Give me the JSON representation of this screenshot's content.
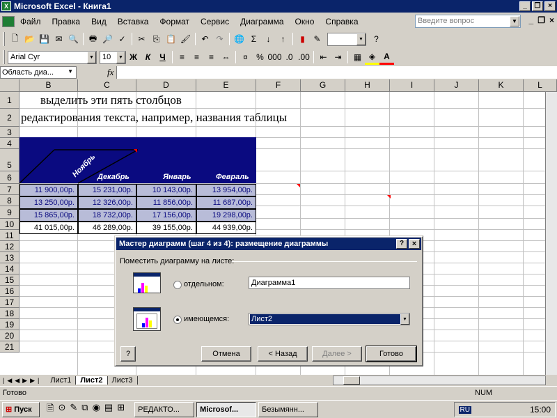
{
  "window": {
    "title": "Microsoft Excel - Книга1",
    "icon": "excel-icon"
  },
  "menu": [
    "Файл",
    "Правка",
    "Вид",
    "Вставка",
    "Формат",
    "Сервис",
    "Диаграмма",
    "Окно",
    "Справка"
  ],
  "help_placeholder": "Введите вопрос",
  "font": {
    "name": "Arial Cyr",
    "size": "10"
  },
  "formula": {
    "namebox": "Область диа...",
    "fx": "fx"
  },
  "columns": [
    "B",
    "C",
    "D",
    "E",
    "F",
    "G",
    "H",
    "I",
    "J",
    "K",
    "L"
  ],
  "rows": [
    "1",
    "2",
    "3",
    "4",
    "5",
    "6",
    "7",
    "8",
    "9",
    "10",
    "11",
    "12",
    "13",
    "14",
    "15",
    "16",
    "17",
    "18",
    "19",
    "20",
    "21"
  ],
  "sheet_text": {
    "r1": "выделить эти пять столбцов",
    "r2": "редактирования текста, например, названия таблицы"
  },
  "table": {
    "headers": [
      "Ноябрь",
      "Декабрь",
      "Январь",
      "Февраль"
    ],
    "rows": [
      [
        "11 900,00р.",
        "15 231,00р.",
        "10 143,00р.",
        "13 954,00р."
      ],
      [
        "13 250,00р.",
        "12 326,00р.",
        "11 856,00р.",
        "11 687,00р."
      ],
      [
        "15 865,00р.",
        "18 732,00р.",
        "17 156,00р.",
        "19 298,00р."
      ],
      [
        "41 015,00р.",
        "46 289,00р.",
        "39 155,00р.",
        "44 939,00р."
      ]
    ],
    "header_color": "#0a0a80",
    "cell_color": "#b8bcd8"
  },
  "dialog": {
    "title": "Мастер диаграмм (шаг 4 из 4): размещение диаграммы",
    "group": "Поместить диаграмму на листе:",
    "opt1_label": "отдельном:",
    "opt1_value": "Диаграмма1",
    "opt2_label": "имеющемся:",
    "opt2_value": "Лист2",
    "buttons": {
      "cancel": "Отмена",
      "back": "< Назад",
      "next": "Далее >",
      "finish": "Готово"
    }
  },
  "tabs": [
    "Лист1",
    "Лист2",
    "Лист3"
  ],
  "status": {
    "left": "Готово",
    "num": "NUM"
  },
  "taskbar": {
    "start": "Пуск",
    "items": [
      "РЕДАКТО...",
      "Microsof...",
      "Безымянн..."
    ],
    "clock": "15:00",
    "lang": "RU"
  }
}
